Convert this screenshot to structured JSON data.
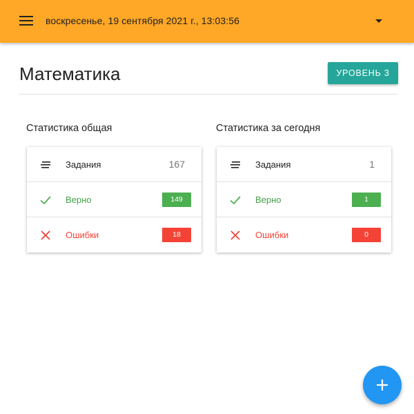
{
  "header": {
    "datetime": "воскресенье, 19 сентября 2021 г., 13:03:56",
    "background_color": "#FFA726",
    "menu_icon": "menu-icon",
    "dropdown_icon": "arrow-drop-down-icon"
  },
  "page": {
    "title": "Математика",
    "level_button": "УРОВЕНЬ 3",
    "level_button_color": "#26A69A"
  },
  "stats_total": {
    "title": "Статистика общая",
    "rows": [
      {
        "icon": "tasks-icon",
        "label": "Задания",
        "value": "167"
      },
      {
        "icon": "check-icon",
        "label": "Верно",
        "value": "149",
        "color": "#4CAF50"
      },
      {
        "icon": "close-icon",
        "label": "Ошибки",
        "value": "18",
        "color": "#F44336"
      }
    ]
  },
  "stats_today": {
    "title": "Статистика за сегодня",
    "rows": [
      {
        "icon": "tasks-icon",
        "label": "Задания",
        "value": "1"
      },
      {
        "icon": "check-icon",
        "label": "Верно",
        "value": "1",
        "color": "#4CAF50"
      },
      {
        "icon": "close-icon",
        "label": "Ошибки",
        "value": "0",
        "color": "#F44336"
      }
    ]
  },
  "fab": {
    "icon": "add-icon",
    "color": "#2196F3"
  }
}
